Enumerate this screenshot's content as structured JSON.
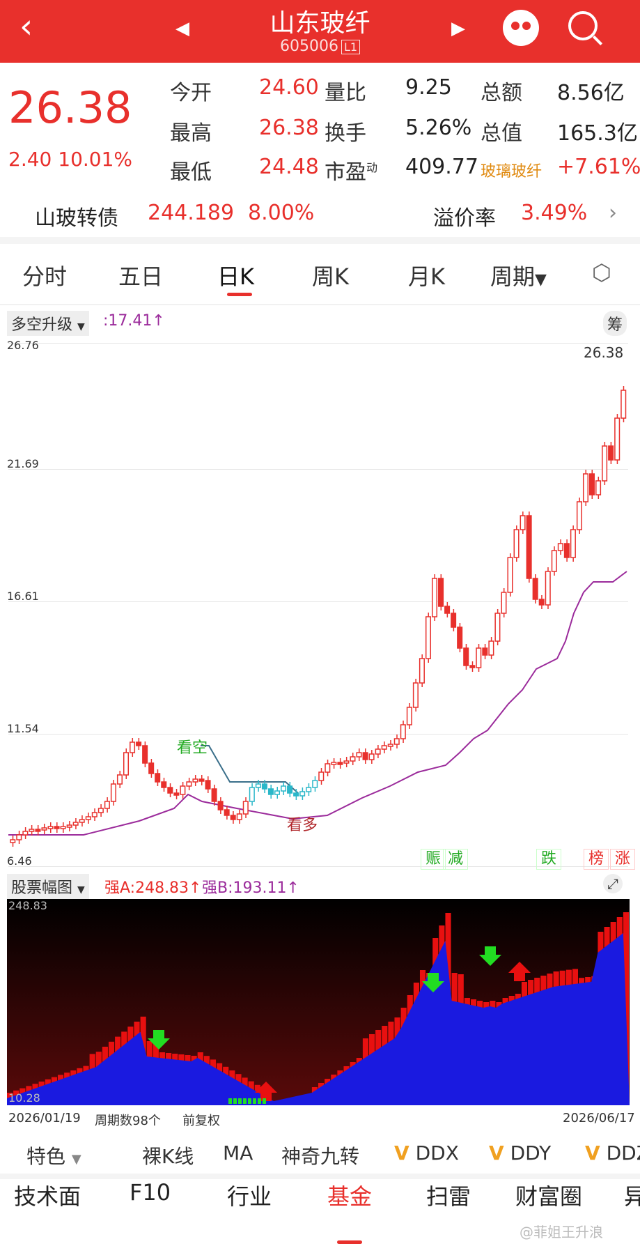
{
  "header": {
    "back_icon": "chevron-left-icon",
    "name": "山东玻纤",
    "code": "605006",
    "level": "L1"
  },
  "quote": {
    "price": "26.38",
    "change": "2.40",
    "change_pct": "10.01%",
    "fields": [
      {
        "label": "今开",
        "value": "24.60"
      },
      {
        "label": "量比",
        "value": "9.25"
      },
      {
        "label": "总额",
        "value": "8.56亿"
      },
      {
        "label": "最高",
        "value": "26.38"
      },
      {
        "label": "换手",
        "value": "5.26%"
      },
      {
        "label": "总值",
        "value": "165.3亿"
      },
      {
        "label": "最低",
        "value": "24.48"
      },
      {
        "label": "市盈",
        "sup": "动",
        "value": "409.77"
      },
      {
        "label": "玻璃玻纤",
        "value": "+7.61%"
      }
    ]
  },
  "bond": {
    "label": "山玻转债",
    "price": "244.189",
    "pct": "8.00%",
    "premium_label": "溢价率",
    "premium": "3.49%"
  },
  "tabs": [
    "分时",
    "五日",
    "日K",
    "周K",
    "月K",
    "周期"
  ],
  "active_tab": "日K",
  "kline": {
    "indicator": "多空升级",
    "indicator_value": ":17.41↑",
    "chip_label": "筹",
    "y_ticks": [
      "26.76",
      "21.69",
      "16.61",
      "11.54",
      "6.46"
    ],
    "last_price_label": "26.38",
    "annot_bear": "看空",
    "annot_bull": "看多",
    "tags": [
      "赈",
      "减",
      "跌",
      "榜",
      "涨"
    ]
  },
  "sub": {
    "indicator": "股票幅图",
    "a_label": "强A:248.83↑",
    "b_label": "强B:193.11↑",
    "y_top": "248.83",
    "y_bottom": "10.28",
    "expand_icon": "expand-icon"
  },
  "footer": {
    "start_date": "2026/01/19",
    "period_count": "周期数98个",
    "adjust": "前复权",
    "end_date": "2026/06/17"
  },
  "features": [
    "特色",
    "裸K线",
    "MA",
    "神奇九转",
    "DDX",
    "DDY",
    "DDZ"
  ],
  "bottom_tabs": [
    "技术面",
    "F10",
    "行业",
    "基金",
    "扫雷",
    "财富圈",
    "异"
  ],
  "active_bottom": "基金",
  "watermark": "@菲姐王升浪",
  "colors": {
    "up": "#e8302c",
    "down": "#2ab7c9",
    "line": "#9b2b9b",
    "blue": "#1a1ae0"
  }
}
